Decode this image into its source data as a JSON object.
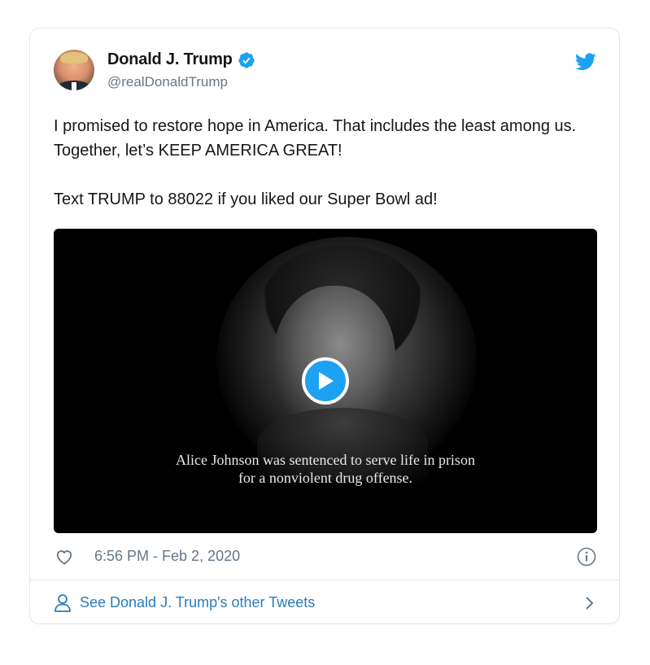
{
  "tweet": {
    "author": {
      "name": "Donald J. Trump",
      "handle": "@realDonaldTrump",
      "verified": true,
      "avatar_icon": "avatar-photo"
    },
    "text_lines": [
      "I promised to restore hope in America. That includes the least among us. Together, let’s KEEP AMERICA GREAT!",
      "Text TRUMP to 88022 if you liked our Super Bowl ad!"
    ],
    "media": {
      "type": "video",
      "caption_line_1": "Alice Johnson was sentenced to serve life in prison",
      "caption_line_2": "for a nonviolent drug offense.",
      "play_icon": "play-icon"
    },
    "timestamp": "6:56 PM - Feb 2, 2020",
    "icons": {
      "like": "heart-icon",
      "info": "info-icon",
      "brand": "twitter-logo-icon",
      "verified": "verified-badge-icon",
      "profile": "person-icon",
      "chevron": "chevron-right-icon"
    },
    "footer_link": "See Donald J. Trump's other Tweets"
  },
  "colors": {
    "brand_blue": "#1da1f2",
    "link_blue": "#2b7bb9",
    "text_primary": "#14171a",
    "text_secondary": "#657786",
    "border": "#e1e8ed"
  }
}
